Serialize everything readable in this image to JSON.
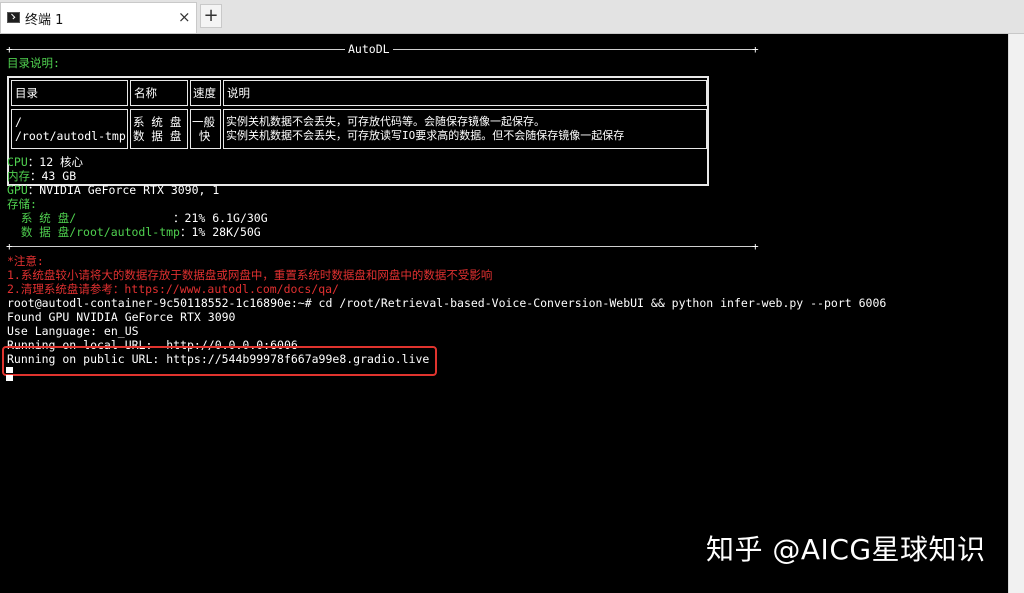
{
  "tab": {
    "title": "终端 1",
    "close_glyph": "×",
    "new_tab_glyph": "+"
  },
  "terminal": {
    "banner_label": "AutoDL",
    "dir_heading": "目录说明:",
    "table": {
      "headers": [
        "目录",
        "名称",
        "速度",
        "说明"
      ],
      "row": {
        "paths": "/\n/root/autodl-tmp",
        "names": "系 统 盘\n数 据 盘",
        "speed": "一般\n 快",
        "descs": "实例关机数据不会丢失，可存放代码等。会随保存镜像一起保存。\n实例关机数据不会丢失，可存放读写IO要求高的数据。但不会随保存镜像一起保存"
      }
    },
    "cpu_label": "CPU",
    "cpu_value": "：12 核心",
    "mem_label": "内存",
    "mem_value": "：43 GB",
    "gpu_label": "GPU",
    "gpu_value": "：NVIDIA GeForce RTX 3090, 1",
    "storage_label": "存储:",
    "sys_disk_label": "  系 统 盘/              ",
    "sys_disk_value": "：21% 6.1G/30G",
    "data_disk_label": "  数 据 盘/root/autodl-tmp",
    "data_disk_value": "：1% 28K/50G",
    "note_heading": "*注意:",
    "note_1": "1.系统盘较小请将大的数据存放于数据盘或网盘中，重置系统时数据盘和网盘中的数据不受影响",
    "note_2": "2.清理系统盘请参考：https://www.autodl.com/docs/qa/",
    "command": "root@autodl-container-9c50118552-1c16890e:~# cd /root/Retrieval-based-Voice-Conversion-WebUI && python infer-web.py --port 6006",
    "out_1": "Found GPU NVIDIA GeForce RTX 3090",
    "out_2": "Use Language: en_US",
    "out_3": "Running on local URL:  http://0.0.0.0:6006",
    "out_4": "Running on public URL: https://544b99978f667a99e8.gradio.live"
  },
  "colors": {
    "prompt_label": "#4fd04f",
    "warning": "#e03030",
    "highlight_box": "#e0342e",
    "background": "#000000"
  },
  "watermark": "知乎 @AICG星球知识"
}
